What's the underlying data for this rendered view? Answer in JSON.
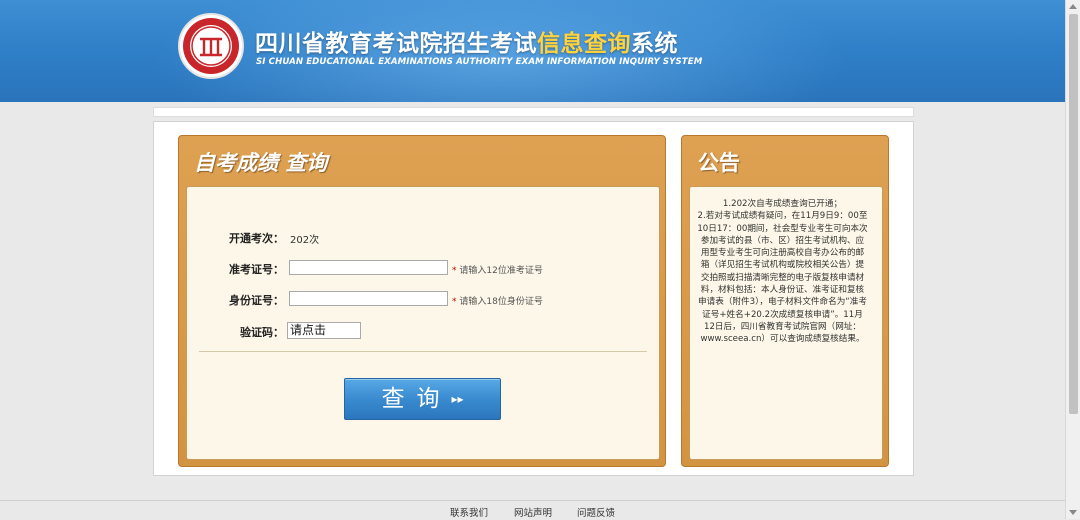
{
  "header": {
    "title_pre": "四川省教育考试院招生考试",
    "title_hl": "信息查询",
    "title_post": "系统",
    "subtitle": "SI CHUAN EDUCATIONAL EXAMINATIONS AUTHORITY EXAM INFORMATION INQUIRY SYSTEM",
    "logo_icon": "seal-logo"
  },
  "query_panel": {
    "title": "自考成绩 查询",
    "session_label": "开通考次：",
    "session_value": "202次",
    "ticket_label": "准考证号：",
    "ticket_value": "",
    "ticket_hint_star": "*",
    "ticket_hint": "请输入12位准考证号",
    "id_label": "身份证号：",
    "id_value": "",
    "id_hint_star": "*",
    "id_hint": "请输入18位身份证号",
    "captcha_label": "验证码：",
    "captcha_text": "请点击",
    "submit_label": "查询",
    "submit_arrow": "▸▸"
  },
  "notice_panel": {
    "title": "公告",
    "paragraphs": [
      "1.202次自考成绩查询已开通；",
      "2.若对考试成绩有疑问，在11月9日9：00至10日17：00期间，社会型专业考生可向本次参加考试的县（市、区）招生考试机构、应用型专业考生可向注册高校自考办公布的邮箱（详见招生考试机构或院校相关公告）提交拍照或扫描清晰完整的电子版复核申请材料，材料包括：本人身份证、准考证和复核申请表（附件3），电子材料文件命名为“准考证号+姓名+20.2次成绩复核申请”。11月12日后，四川省教育考试院官网（网址：www.sceea.cn）可以查询成绩复核结果。"
    ]
  },
  "footer": {
    "links": [
      "联系我们",
      "网站声明",
      "问题反馈"
    ]
  },
  "colors": {
    "header_blue": "#2f7fc8",
    "panel_orange": "#d59a45",
    "title_highlight": "#ffd33d",
    "button_blue": "#3a8bd0"
  }
}
